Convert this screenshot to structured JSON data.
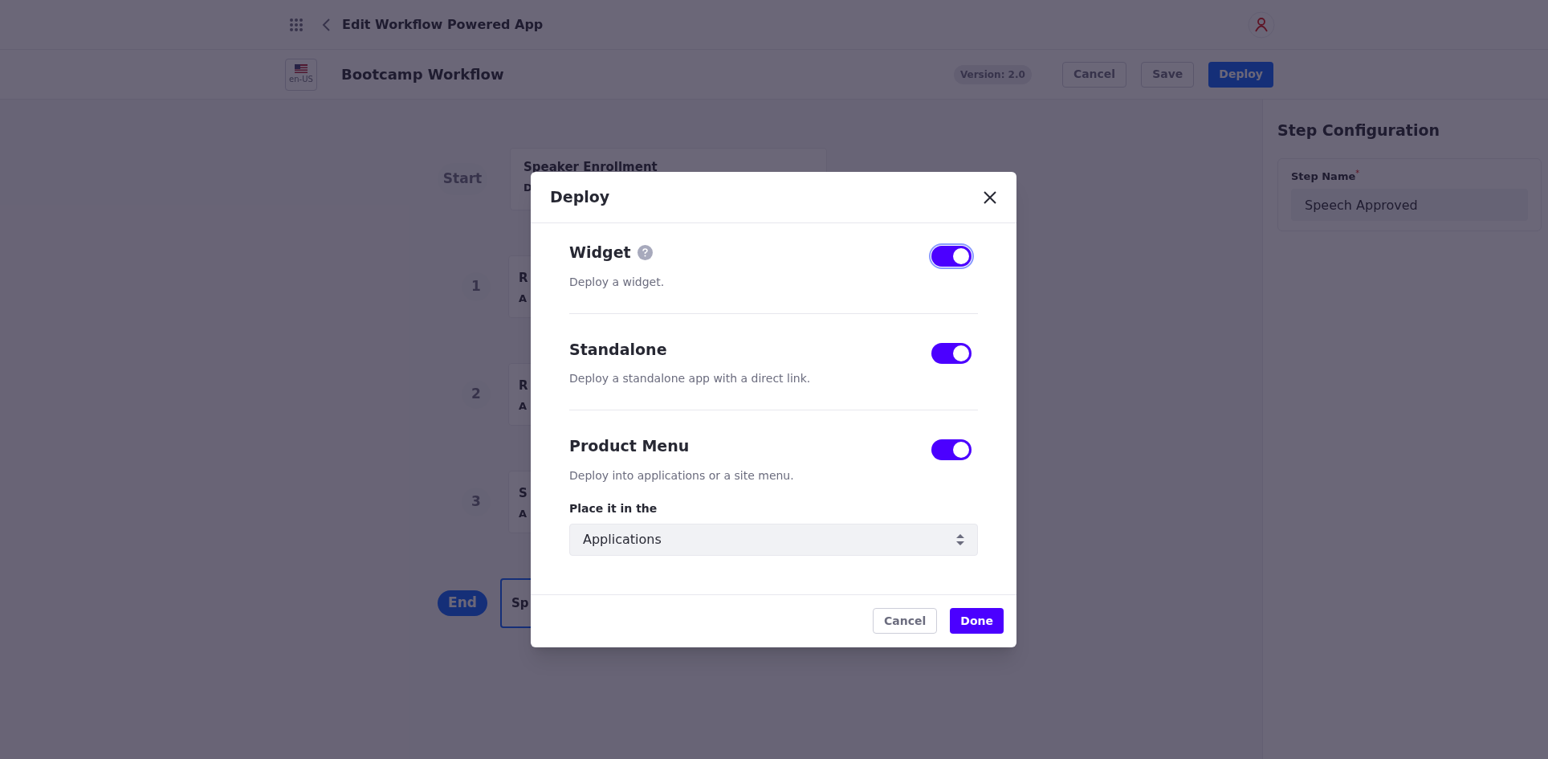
{
  "header": {
    "title": "Edit Workflow Powered App"
  },
  "toolbar": {
    "locale": "en-US",
    "workflow_name": "Bootcamp Workflow",
    "version": "Version: 2.0",
    "buttons": [
      {
        "label": "Cancel",
        "kind": "secondary"
      },
      {
        "label": "Save",
        "kind": "secondary"
      },
      {
        "label": "Deploy",
        "kind": "primary"
      }
    ]
  },
  "workflow": {
    "start_label": "Start",
    "start_card": {
      "title": "Speaker Enrollment",
      "subtitle": "D"
    },
    "steps": [
      {
        "number": "1",
        "title": "R",
        "subtitle": "A"
      },
      {
        "number": "2",
        "title": "R",
        "subtitle": "A"
      },
      {
        "number": "3",
        "title": "S",
        "subtitle": "A"
      }
    ],
    "end_label": "End",
    "end_card": {
      "title": "Sp",
      "selected": true
    }
  },
  "step_configuration": {
    "title": "Step Configuration",
    "field_label": "Step Name",
    "required_mark": "*",
    "value": "Speech Approved"
  },
  "dialog": {
    "title": "Deploy",
    "options": [
      {
        "title": "Widget",
        "help": true,
        "description": "Deploy a widget.",
        "on": true,
        "focused": true
      },
      {
        "title": "Standalone",
        "help": false,
        "description": "Deploy a standalone app with a direct link.",
        "on": true,
        "focused": false
      },
      {
        "title": "Product Menu",
        "help": false,
        "description": "Deploy into applications or a site menu.",
        "on": true,
        "focused": false
      }
    ],
    "select": {
      "label": "Place it in the",
      "value": "Applications"
    },
    "buttons": [
      {
        "label": "Cancel",
        "kind": "secondary"
      },
      {
        "label": "Done",
        "kind": "primary"
      }
    ]
  }
}
